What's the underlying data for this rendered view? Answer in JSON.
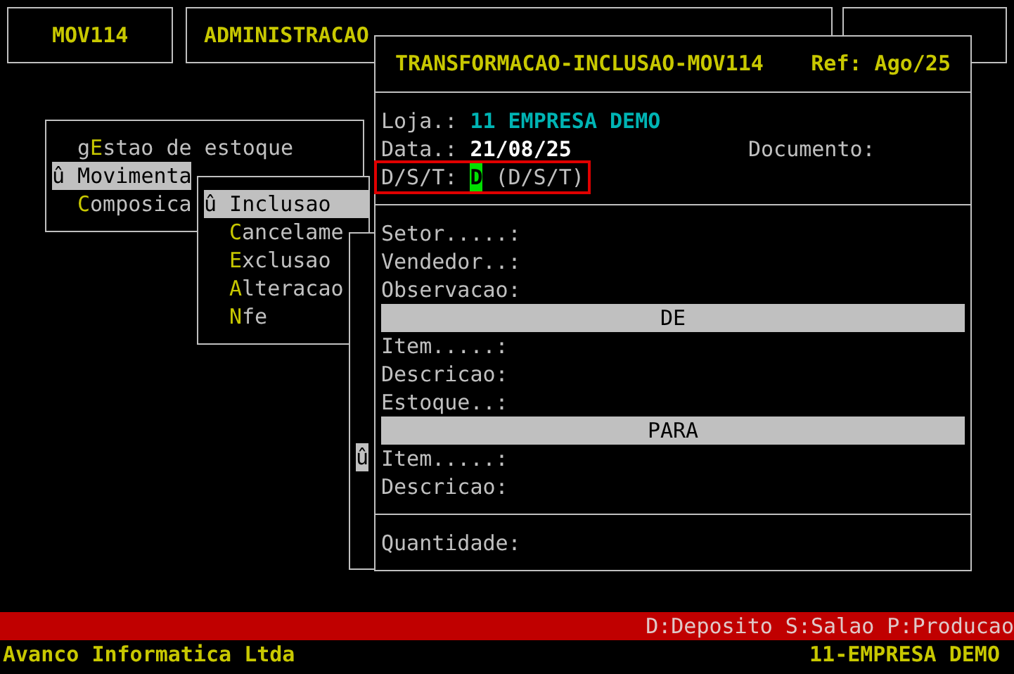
{
  "header": {
    "program": "MOV114",
    "module": "ADMINISTRACAO"
  },
  "menu": {
    "items": [
      {
        "label": "g**E**stao de estoque",
        "selected": false
      },
      {
        "label": "û Movimenta",
        "selected": true
      },
      {
        "label": "**C**omposica",
        "selected": false
      }
    ]
  },
  "submenu": {
    "items": [
      {
        "label": "û Inclusao",
        "selected": true
      },
      {
        "label": "**C**ancelame",
        "selected": false
      },
      {
        "label": "**E**xclusao",
        "selected": false
      },
      {
        "label": "**A**lteracao",
        "selected": false
      },
      {
        "label": "**N**fe",
        "selected": false
      }
    ]
  },
  "side_menu": {
    "items": [
      {
        "label": "û",
        "selected": true
      }
    ]
  },
  "form": {
    "title": "TRANSFORMACAO-INCLUSAO-MOV114",
    "ref": "Ref: Ago/25",
    "loja": {
      "label": "Loja.:",
      "value": "11 EMPRESA DEMO"
    },
    "data": {
      "label": "Data.:",
      "value": "21/08/25"
    },
    "documento": {
      "label": "Documento:"
    },
    "dst": {
      "label": "D/S/T:",
      "value": "D",
      "hint": "(D/S/T)",
      "focused": true
    },
    "sections": [
      {
        "kind": "field",
        "label": "Setor.....:"
      },
      {
        "kind": "field",
        "label": "Vendedor..:"
      },
      {
        "kind": "field",
        "label": "Observacao:"
      },
      {
        "kind": "band",
        "label": "DE"
      },
      {
        "kind": "field",
        "label": "Item.....:"
      },
      {
        "kind": "field",
        "label": "Descricao:"
      },
      {
        "kind": "field",
        "label": "Estoque..:"
      },
      {
        "kind": "band",
        "label": "PARA"
      },
      {
        "kind": "field",
        "label": "Item.....:"
      },
      {
        "kind": "field",
        "label": "Descricao:"
      }
    ],
    "quantidade": {
      "label": "Quantidade:"
    }
  },
  "status_bar": {
    "hint": "D:Deposito S:Salao P:Producao",
    "company": "Avanco Informatica Ltda",
    "store": "11-EMPRESA DEMO"
  }
}
